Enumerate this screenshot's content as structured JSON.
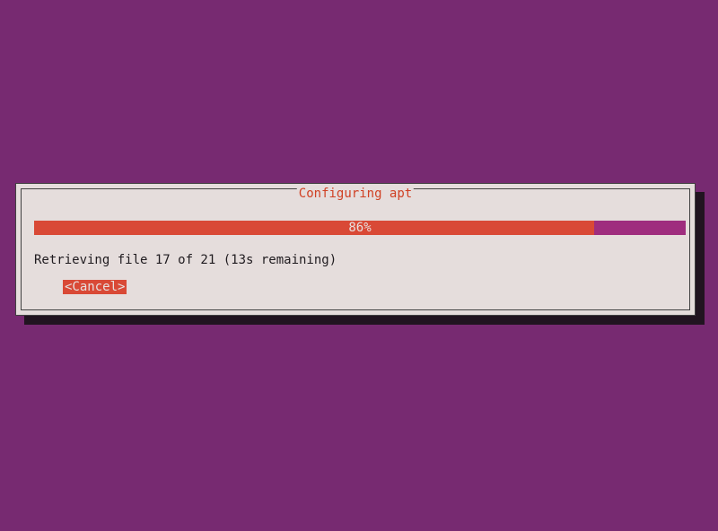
{
  "dialog": {
    "title": "Configuring apt",
    "progress_percent_label": "86%",
    "progress_percent": 86,
    "status": "Retrieving file 17 of 21 (13s remaining)",
    "cancel_label": "<Cancel>"
  }
}
